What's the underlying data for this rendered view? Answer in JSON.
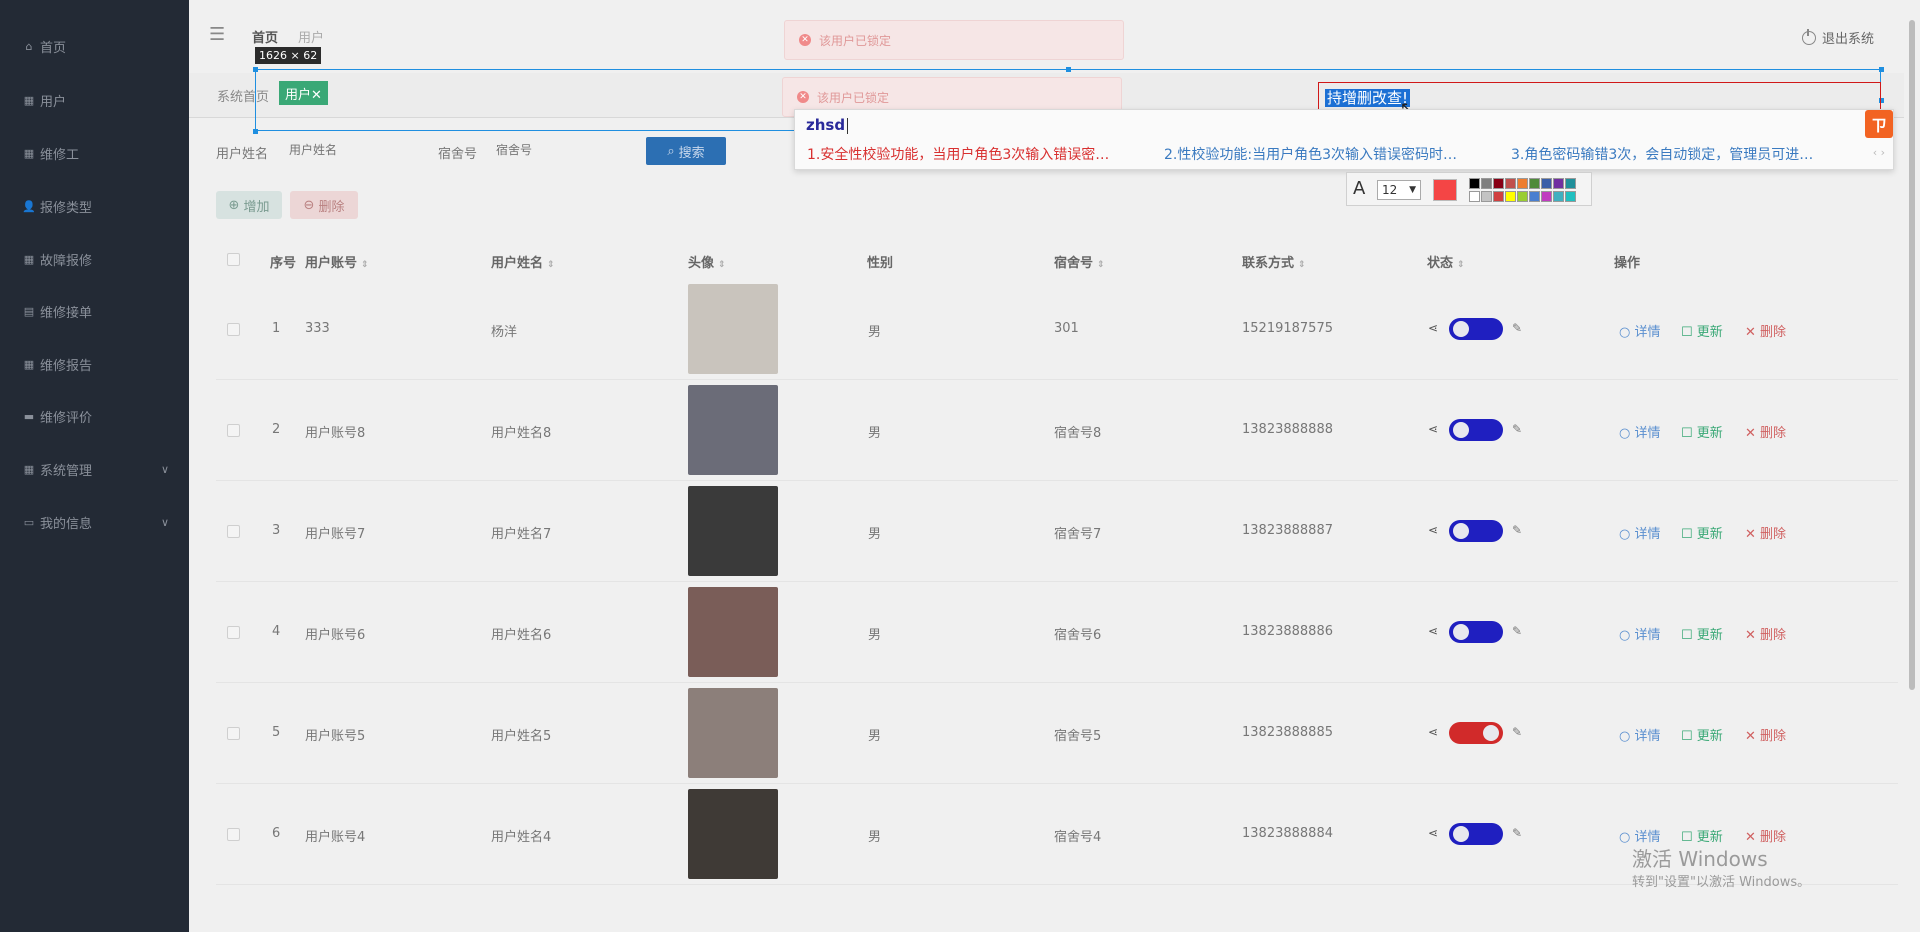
{
  "sidebar": {
    "items": [
      {
        "label": "首页",
        "icon": "home-icon",
        "glyph": "⌂"
      },
      {
        "label": "用户",
        "icon": "grid-icon",
        "glyph": "▦"
      },
      {
        "label": "维修工",
        "icon": "grid-icon",
        "glyph": "▦"
      },
      {
        "label": "报修类型",
        "icon": "user-icon",
        "glyph": "👤"
      },
      {
        "label": "故障报修",
        "icon": "grid-icon",
        "glyph": "▦"
      },
      {
        "label": "维修接单",
        "icon": "inbox-icon",
        "glyph": "▤"
      },
      {
        "label": "维修报告",
        "icon": "grid-icon",
        "glyph": "▦"
      },
      {
        "label": "维修评价",
        "icon": "card-icon",
        "glyph": "▬"
      },
      {
        "label": "系统管理",
        "icon": "grid-icon",
        "glyph": "▦"
      },
      {
        "label": "我的信息",
        "icon": "calendar-icon",
        "glyph": "▭"
      }
    ]
  },
  "header": {
    "breadcrumb_home": "首页",
    "breadcrumb_current": "用户",
    "logout": "退出系统"
  },
  "tabs": {
    "home": "系统首页",
    "active": "用户✕"
  },
  "toasts": [
    {
      "text": "该用户已锁定"
    },
    {
      "text": "该用户已锁定"
    }
  ],
  "search": {
    "username_label": "用户姓名",
    "username_placeholder": "用户姓名",
    "dorm_label": "宿舍号",
    "dorm_placeholder": "宿舍号",
    "search_button": "搜索"
  },
  "actions": {
    "add": "增加",
    "delete": "删除"
  },
  "table": {
    "headers": [
      "序号",
      "用户账号",
      "用户姓名",
      "头像",
      "性别",
      "宿舍号",
      "联系方式",
      "状态",
      "操作"
    ],
    "op_labels": {
      "detail": "详情",
      "update": "更新",
      "delete": "删除"
    },
    "rows": [
      {
        "index": "1",
        "account": "333",
        "name": "杨洋",
        "gender": "男",
        "dorm": "301",
        "phone": "15219187575",
        "status_on": false,
        "avatar_color": "#c9c4bd"
      },
      {
        "index": "2",
        "account": "用户账号8",
        "name": "用户姓名8",
        "gender": "男",
        "dorm": "宿舍号8",
        "phone": "13823888888",
        "status_on": false,
        "avatar_color": "#6b6c78"
      },
      {
        "index": "3",
        "account": "用户账号7",
        "name": "用户姓名7",
        "gender": "男",
        "dorm": "宿舍号7",
        "phone": "13823888887",
        "status_on": false,
        "avatar_color": "#3a3a3a"
      },
      {
        "index": "4",
        "account": "用户账号6",
        "name": "用户姓名6",
        "gender": "男",
        "dorm": "宿舍号6",
        "phone": "13823888886",
        "status_on": false,
        "avatar_color": "#7a5d58"
      },
      {
        "index": "5",
        "account": "用户账号5",
        "name": "用户姓名5",
        "gender": "男",
        "dorm": "宿舍号5",
        "phone": "13823888885",
        "status_on": true,
        "avatar_color": "#8c7f7a"
      },
      {
        "index": "6",
        "account": "用户账号4",
        "name": "用户姓名4",
        "gender": "男",
        "dorm": "宿舍号4",
        "phone": "13823888884",
        "status_on": false,
        "avatar_color": "#3f3a36"
      }
    ]
  },
  "overlay": {
    "selection_size": "1626 × 62",
    "selected_text": "持增删改查!"
  },
  "ime": {
    "composition": "zhsd",
    "candidates": [
      "1.安全性校验功能，当用户角色3次输入错误密…",
      "2.性校验功能:当用户角色3次输入错误密码时…",
      "3.角色密码输错3次，会自动锁定，管理员可进…"
    ],
    "nav": "‹ ›",
    "logo": "ㄗ"
  },
  "format_toolbar": {
    "font_icon": "A",
    "font_size": "12",
    "current_color": "#f44545",
    "swatches_top": [
      "#000000",
      "#7f7f7f",
      "#880015",
      "#c0504d",
      "#ed7d31",
      "#4f8a3a",
      "#3a5ea8",
      "#7030a0",
      "#1f8f9a"
    ],
    "swatches_bottom": [
      "#ffffff",
      "#c3c3c3",
      "#d04040",
      "#ffff00",
      "#9acd32",
      "#4a7fd0",
      "#c03cc0",
      "#40b0c0",
      "#20c0c0"
    ]
  },
  "watermark": {
    "line1": "激活 Windows",
    "line2": "转到\"设置\"以激活 Windows。"
  }
}
